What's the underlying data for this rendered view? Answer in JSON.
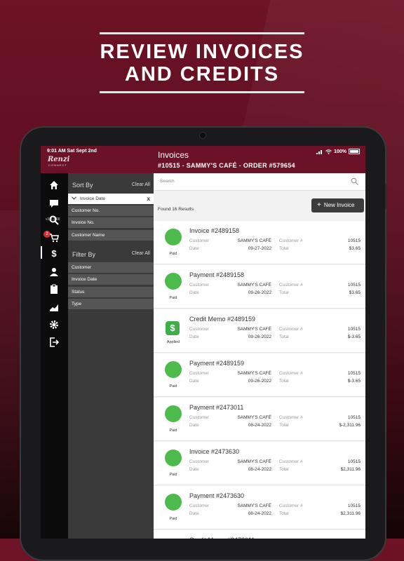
{
  "headline": {
    "line1": "REVIEW INVOICES",
    "line2": "AND CREDITS"
  },
  "status": {
    "time": "9:01 AM  Sat Sept 2nd",
    "battery": "100%"
  },
  "app": {
    "logo": "Renzi",
    "logo_sub": "CONNECT",
    "version": "v3.8.3.68"
  },
  "header": {
    "title": "Invoices",
    "subtitle": "#10515 - SAMMY'S CAFÉ - ORDER #579654"
  },
  "nav": {
    "cart_badge": "2"
  },
  "sort": {
    "heading": "Sort By",
    "clear": "Clear All",
    "selected": "Invoice Date",
    "selected_icon": "x",
    "options": [
      "Customer No.",
      "Invoice No.",
      "Customer Name"
    ]
  },
  "filter": {
    "heading": "Filter By",
    "clear": "Clear All",
    "options": [
      "Customer",
      "Invoice Date",
      "Status",
      "Type"
    ]
  },
  "search": {
    "placeholder": "Search"
  },
  "results": {
    "found": "Found 16 Results",
    "new_label": "New Invoice"
  },
  "labels": {
    "customer": "Customer",
    "date": "Date",
    "customer_num": "Customer #",
    "total": "Total"
  },
  "items": [
    {
      "title": "Invoice #2489158",
      "status": "Paid",
      "customer": "SAMMY'S CAFÉ",
      "date": "09-27-2022",
      "customer_num": "10515",
      "total": "$3.65"
    },
    {
      "title": "Payment #2489158",
      "status": "Paid",
      "customer": "SAMMY'S CAFÉ",
      "date": "09-26-2022",
      "customer_num": "10515",
      "total": "$3.65"
    },
    {
      "title": "Credit Memo #2489159",
      "status": "Applied",
      "customer": "SAMMY'S CAFÉ",
      "date": "09-26-2022",
      "customer_num": "10515",
      "total": "$-3.65"
    },
    {
      "title": "Payment #2489159",
      "status": "Paid",
      "customer": "SAMMY'S CAFÉ",
      "date": "09-26-2022",
      "customer_num": "10515",
      "total": "$-3.65"
    },
    {
      "title": "Payment #2473011",
      "status": "Paid",
      "customer": "SAMMY'S CAFÉ",
      "date": "08-24-2022",
      "customer_num": "10515",
      "total": "$-2,311.96"
    },
    {
      "title": "Invoice #2473630",
      "status": "Paid",
      "customer": "SAMMY'S CAFÉ",
      "date": "08-24-2022",
      "customer_num": "10515",
      "total": "$2,311.96"
    },
    {
      "title": "Payment #2473630",
      "status": "Paid",
      "customer": "SAMMY'S CAFÉ",
      "date": "08-24-2022",
      "customer_num": "10515",
      "total": "$2,311.96"
    },
    {
      "title": "Credit Memo #2473011",
      "status": "",
      "customer": "",
      "date": "",
      "customer_num": "",
      "total": ""
    }
  ],
  "colors": {
    "brand": "#6b1226",
    "paid_green": "#4cbb4c",
    "applied_green": "#3fae49"
  }
}
